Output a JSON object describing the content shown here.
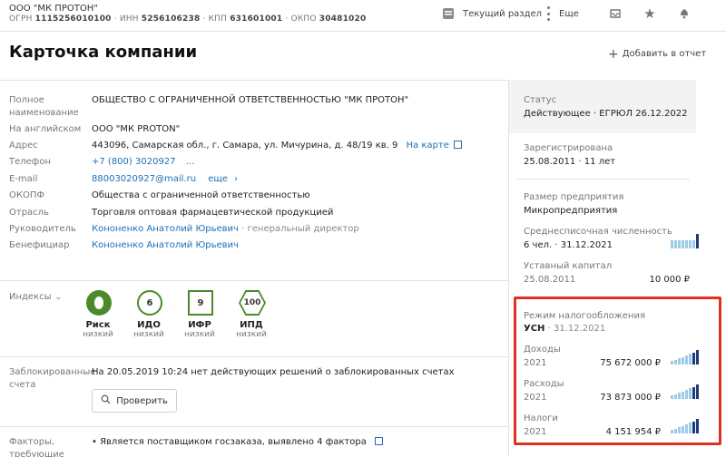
{
  "header": {
    "company_short": "ООО \"МК ПРОТОН\"",
    "ogrn_label": "ОГРН",
    "ogrn": "1115256010100",
    "inn_label": "ИНН",
    "inn": "5256106238",
    "kpp_label": "КПП",
    "kpp": "631601001",
    "okpo_label": "ОКПО",
    "okpo": "30481020",
    "current_section": "Текущий раздел",
    "more": "Еще"
  },
  "page": {
    "title": "Карточка компании",
    "add_report": "Добавить в отчет"
  },
  "details": [
    {
      "label": "Полное наименование",
      "value": "ОБЩЕСТВО С ОГРАНИЧЕННОЙ ОТВЕТСТВЕННОСТЬЮ \"МК ПРОТОН\""
    },
    {
      "label": "На английском",
      "value": "ООО \"МК PROTON\""
    },
    {
      "label": "Адрес",
      "value": "443096, Самарская обл., г. Самара, ул. Мичурина, д. 48/19 кв. 9",
      "link": "На карте"
    },
    {
      "label": "Телефон",
      "value": "+7 (800) 3020927",
      "more": "..."
    },
    {
      "label": "E-mail",
      "value": "88003020927@mail.ru",
      "more": "еще"
    },
    {
      "label": "ОКОПФ",
      "value": "Общества с ограниченной ответственностью"
    },
    {
      "label": "Отрасль",
      "value": "Торговля оптовая фармацевтической продукцией"
    },
    {
      "label": "Руководитель",
      "value": "Кононенко Анатолий Юрьевич",
      "extra": "· генеральный директор"
    },
    {
      "label": "Бенефициар",
      "value": "Кононенко Анатолий Юрьевич"
    }
  ],
  "indices": {
    "label": "Индексы",
    "items": [
      {
        "badge": "",
        "name": "Риск",
        "level": "низкий"
      },
      {
        "badge": "6",
        "name": "ИДО",
        "level": "низкий"
      },
      {
        "badge": "9",
        "name": "ИФР",
        "level": "низкий"
      },
      {
        "badge": "100",
        "name": "ИПД",
        "level": "низкий"
      }
    ]
  },
  "blocked": {
    "label": "Заблокированные счета",
    "text": "На 20.05.2019 10:24 нет действующих решений о заблокированных счетах",
    "button": "Проверить"
  },
  "factors": {
    "label": "Факторы, требующие",
    "text": "• Является поставщиком госзаказа, выявлено 4 фактора"
  },
  "sidebar": {
    "status_label": "Статус",
    "status_value": "Действующее · ЕГРЮЛ 26.12.2022",
    "registered_label": "Зарегистрирована",
    "registered_value": "25.08.2011 · 11 лет",
    "size_label": "Размер предприятия",
    "size_value": "Микропредприятия",
    "staff_label": "Среднесписочная численность",
    "staff_value": "6 чел. · 31.12.2021",
    "capital_label": "Уставный капитал",
    "capital_date": "25.08.2011",
    "capital_value": "10 000 ₽",
    "tax_label": "Режим налогообложения",
    "tax_value": "УСН",
    "tax_date": "· 31.12.2021",
    "income_label": "Доходы",
    "income_year": "2021",
    "income_value": "75 672 000 ₽",
    "expense_label": "Расходы",
    "expense_year": "2021",
    "expense_value": "73 873 000 ₽",
    "taxes_label": "Налоги",
    "taxes_year": "2021",
    "taxes_value": "4 151 954 ₽"
  },
  "colors": {
    "accent_link": "#1f6fb5",
    "highlight_box": "#e03022",
    "badge_green": "#4a8a2a"
  }
}
